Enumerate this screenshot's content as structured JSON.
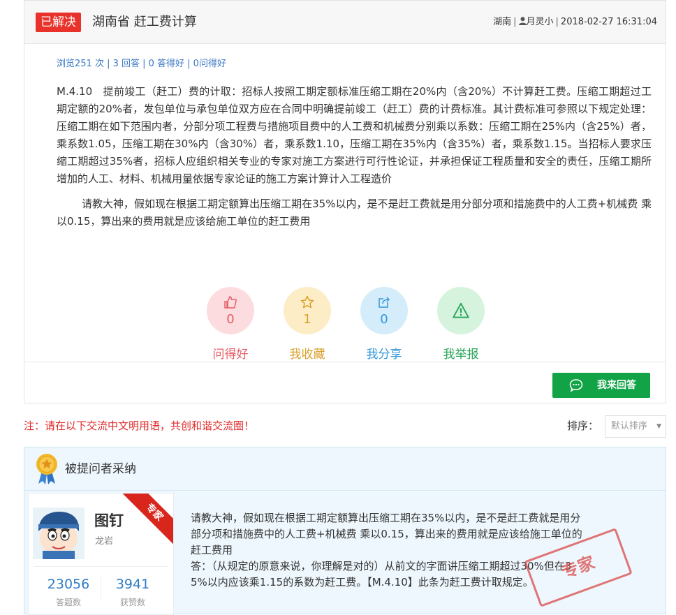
{
  "question": {
    "status": "已解决",
    "title": "湖南省 赶工费计算",
    "meta": {
      "region": "湖南",
      "author": "月灵小",
      "datetime": "2018-02-27 16:31:04"
    },
    "stats": "浏览251 次 | 3 回答 | 0 答得好 | 0问得好",
    "paragraphs": [
      "M.4.10　提前竣工（赶工）费的计取：招标人按照工期定额标准压缩工期在20%内（含20%）不计算赶工费。压缩工期超过工期定额的20%者，发包单位与承包单位双方应在合同中明确提前竣工（赶工）费的计费标准。其计费标准可参照以下规定处理：压缩工期在如下范围内者，分部分项工程费与措施项目费中的人工费和机械费分别乘以系数：压缩工期在25%内（含25%）者，乘系数1.05，压缩工期在30%内（含30%）者，乘系数1.10，压缩工期在35%内（含35%）者，乘系数1.15。当招标人要求压缩工期超过35%者，招标人应组织相关专业的专家对施工方案进行可行性论证，并承担保证工程质量和安全的责任，压缩工期所增加的人工、材料、机械用量依据专家论证的施工方案计算计入工程造价",
      "请教大神，假如现在根据工期定额算出压缩工期在35%以内，是不是赶工费就是用分部分项和措施费中的人工费+机械费 乘以0.15，算出来的费用就是应该给施工单位的赶工费用"
    ]
  },
  "actions": {
    "like": {
      "count": "0",
      "label": "问得好"
    },
    "favorite": {
      "count": "1",
      "label": "我收藏"
    },
    "share": {
      "count": "0",
      "label": "我分享"
    },
    "report": {
      "label": "我举报"
    }
  },
  "answer_button": "我来回答",
  "notice": "注：请在以下交流中文明用语，共创和谐交流圈！",
  "sort": {
    "label": "排序：",
    "selected": "默认排序"
  },
  "adopted": {
    "title": "被提问者采纳",
    "user": {
      "name": "图钉",
      "location": "龙岩",
      "ribbon": "专家",
      "answers": {
        "value": "23056",
        "label": "答题数"
      },
      "likes": {
        "value": "3941",
        "label": "获赞数"
      }
    },
    "answer_lines": [
      "请教大神，假如现在根据工期定额算出压缩工期在35%以内，是不是赶工费就是用分",
      "部分项和措施费中的人工费+机械费 乘以0.15，算出来的费用就是应该给施工单位的",
      "赶工费用",
      "答：（从规定的原意来说，你理解是对的）从前文的字面讲压缩工期超过30%但在3",
      "5%以内应该乘1.15的系数为赶工费。【M.4.10】此条为赶工费计取规定。"
    ],
    "stamp": "专家"
  },
  "colors": {
    "badge_red": "#e8322b",
    "link_blue": "#3a78c3",
    "answer_green": "#12a346",
    "notice_red": "#e02a2a"
  }
}
